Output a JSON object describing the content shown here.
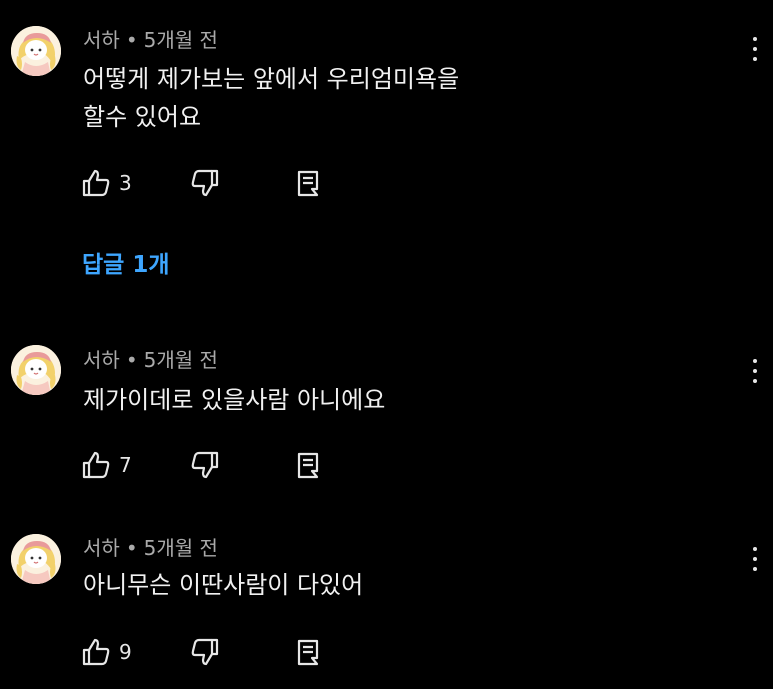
{
  "comments": [
    {
      "author": "서하",
      "time": "5개월 전",
      "text": "어떻게 제가보는 앞에서 우리엄미욕을\n할수 있어요",
      "likes": "3"
    },
    {
      "author": "서하",
      "time": "5개월 전",
      "text": "제가이데로 있을사람 아니에요",
      "likes": "7"
    },
    {
      "author": "서하",
      "time": "5개월 전",
      "text": "아니무슨 이딴사람이 다있어",
      "likes": "9"
    }
  ],
  "replies_link": "답글 1개",
  "separator": "•",
  "icons": {
    "like": "thumbs-up-icon",
    "dislike": "thumbs-down-icon",
    "reply": "comment-reply-icon",
    "menu": "more-vert-icon"
  },
  "colors": {
    "background": "#000000",
    "text": "#f1f1f1",
    "meta": "#aaaaaa",
    "link": "#3ea6ff"
  }
}
